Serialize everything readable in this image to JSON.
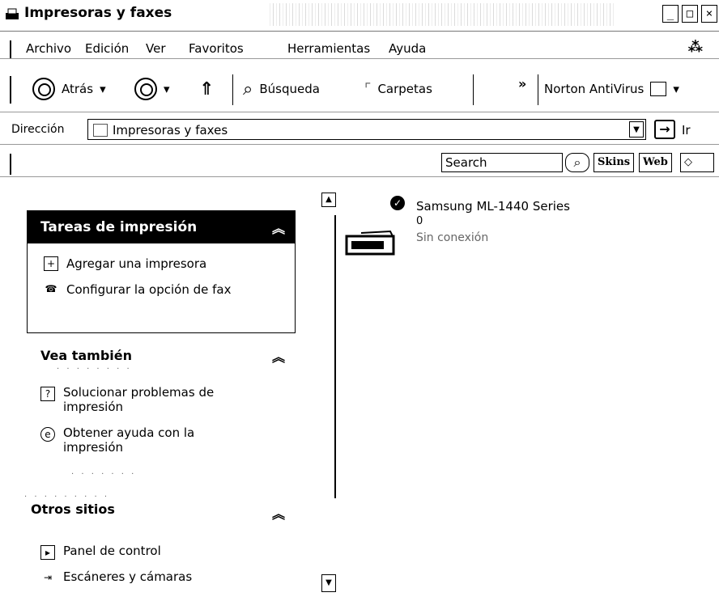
{
  "window": {
    "title": "Impresoras y faxes",
    "buttons": [
      "_",
      "□",
      "×"
    ]
  },
  "menu": [
    "Archivo",
    "Edición",
    "Ver",
    "Favoritos",
    "Herramientas",
    "Ayuda"
  ],
  "toolbar": {
    "back_label": "Atrás",
    "search_label": "Búsqueda",
    "folders_label": "Carpetas",
    "more_label": "»",
    "norton_label": "Norton AntiVirus"
  },
  "address": {
    "label": "Dirección",
    "value": "Impresoras y faxes",
    "go_label": "Ir"
  },
  "searchbar": {
    "placeholder": "Search",
    "skins_label": "Skins",
    "web_label": "Web"
  },
  "panel": {
    "tasks": {
      "title": "Tareas de impresión",
      "items": [
        "Agregar una impresora",
        "Configurar la opción de fax"
      ]
    },
    "see_also": {
      "title": "Vea también",
      "items": [
        "Solucionar problemas de impresión",
        "Obtener ayuda con la impresión"
      ]
    },
    "other_places": {
      "title": "Otros sitios",
      "items": [
        "Panel de control",
        "Escáneres y cámaras"
      ]
    }
  },
  "printer": {
    "name": "Samsung ML-1440 Series",
    "jobs": "0",
    "status": "Sin conexión"
  },
  "icons": {
    "title_icon": "printer-fax-icon",
    "back": "back-arrow-icon",
    "forward": "forward-arrow-icon",
    "up": "up-folder-icon",
    "search": "search-icon",
    "folders": "folders-icon",
    "go": "go-arrow-icon"
  }
}
